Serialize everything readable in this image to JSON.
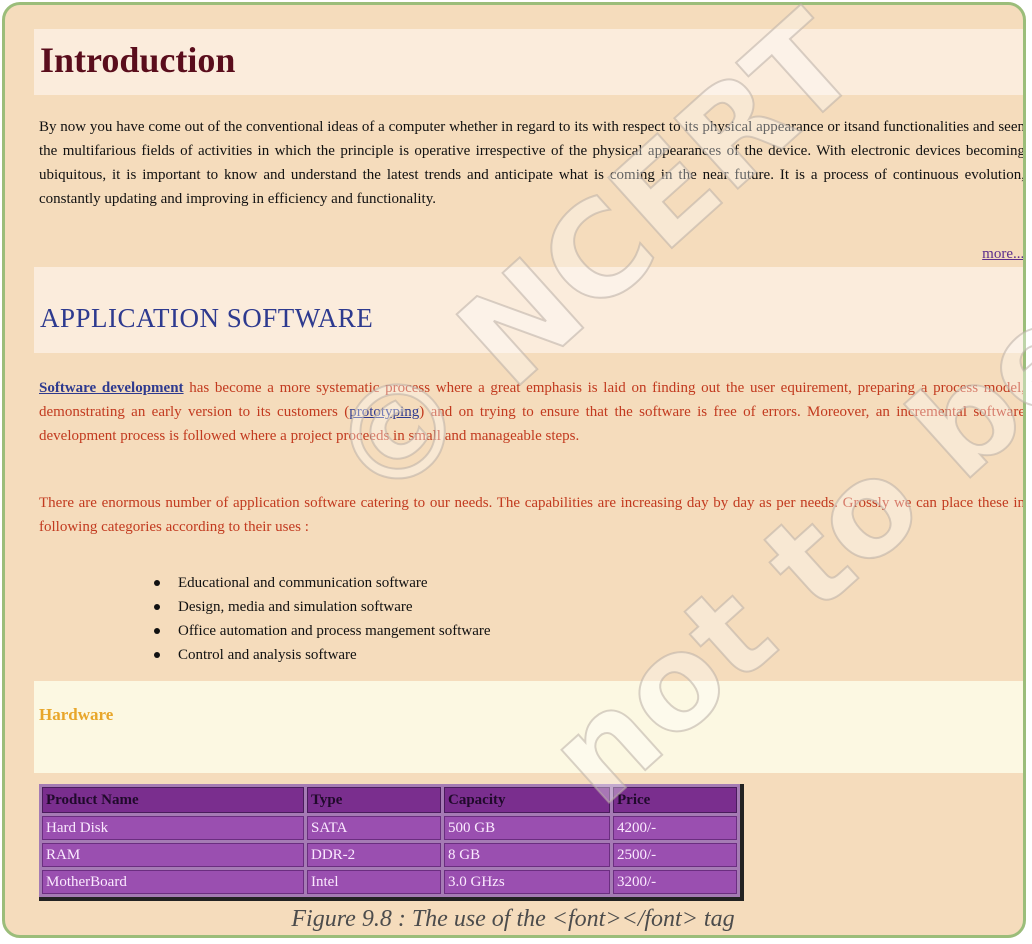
{
  "intro": {
    "title": "Introduction",
    "paragraph": "By now you have come out of the conventional ideas of a computer whether in regard to its with respect to its physical appearance or itsand functionalities and seen the multifarious fields of activities in which the principle is operative irrespective of the physical appearances of the device. With electronic devices becoming ubiquitous, it is important to know and understand the latest trends and anticipate what is coming in the near future. It is a process of continuous evolution, constantly updating and improving in efficiency and functionality.",
    "more_link": "more...."
  },
  "application": {
    "title": "APPLICATION SOFTWARE",
    "software_link": "Software development",
    "para1_a": " has become a more systematic process where a great emphasis is laid on finding out the user equirement, preparing a process model, demonstrating an early version to its customers (",
    "prototyping_link": "prototyping",
    "para1_b": ") and on trying to ensure that the software is free of errors. Moreover, an incremental software development process is followed where a project proceeds in small and manageable steps.",
    "para2": "There are enormous number of application software catering to our needs. The capabilities are increasing day by day as per needs. Grossly we can place these in following categories according to their uses :",
    "categories": [
      "Educational and communication software",
      "Design, media and simulation software",
      "Office automation and process mangement software",
      "Control and analysis software"
    ]
  },
  "hardware": {
    "title": "Hardware",
    "headers": [
      "Product Name",
      "Type",
      "Capacity",
      "Price"
    ],
    "rows": [
      [
        "Hard Disk",
        "SATA",
        "500 GB",
        "4200/-"
      ],
      [
        "RAM",
        "DDR-2",
        "8 GB",
        "2500/-"
      ],
      [
        "MotherBoard",
        "Intel",
        "3.0 GHzs",
        "3200/-"
      ]
    ]
  },
  "caption": "Figure 9.8 : The use of the <font></font> tag",
  "watermark": {
    "line1": "© NCERT",
    "line2": "not to be republished"
  },
  "colors": {
    "page_background": "#f5dcbc",
    "intro_title": "#5a0d1c",
    "app_title": "#2e3a8f",
    "red_text": "#c23a1f",
    "hardware_title": "#e8a62a",
    "table_cell": "#9a4fb0",
    "table_header": "#7a2e8e",
    "frame_border": "#9bbd7a"
  }
}
